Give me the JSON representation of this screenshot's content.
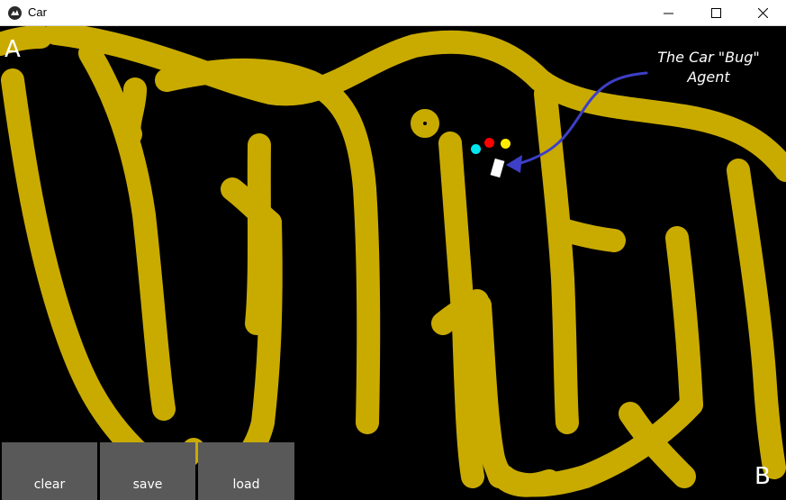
{
  "window": {
    "title": "Car",
    "app_icon": "kivy-logo-icon",
    "controls": [
      "minimize-icon",
      "maximize-icon",
      "close-icon"
    ]
  },
  "canvas": {
    "background_color": "#000000",
    "track_color": "#c9ab00",
    "start_label": "A",
    "goal_label": "B",
    "annotation_line1": "The Car \"Bug\"",
    "annotation_line2": "Agent",
    "arrow_color": "#3e3fc7",
    "agent": {
      "car_color": "#ffffff",
      "sensor_colors": [
        "#00e5ee",
        "#ff0000",
        "#ffee00"
      ]
    }
  },
  "buttons": {
    "clear": "clear",
    "save": "save",
    "load": "load",
    "color": "#595959"
  }
}
